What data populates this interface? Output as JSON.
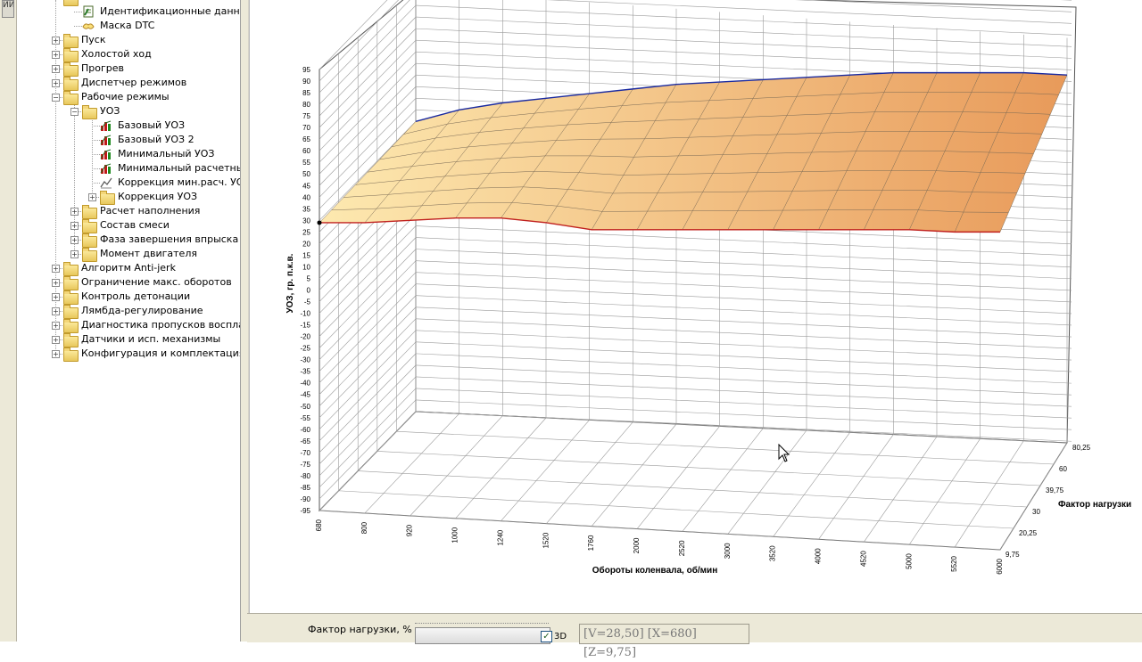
{
  "left_edge_tab": "ИИ",
  "tree": {
    "top_partial": "",
    "items": [
      {
        "label": "Идентификационные данные",
        "type": "doc",
        "level": 2
      },
      {
        "label": "Маска DTC",
        "type": "mask",
        "level": 2
      },
      {
        "label": "Пуск",
        "type": "folder",
        "level": 1,
        "expanded": false
      },
      {
        "label": "Холостой ход",
        "type": "folder",
        "level": 1,
        "expanded": false
      },
      {
        "label": "Прогрев",
        "type": "folder",
        "level": 1,
        "expanded": false
      },
      {
        "label": "Диспетчер режимов",
        "type": "folder",
        "level": 1,
        "expanded": false
      },
      {
        "label": "Рабочие режимы",
        "type": "folder",
        "level": 1,
        "expanded": true
      },
      {
        "label": "УОЗ",
        "type": "folder",
        "level": 2,
        "expanded": true
      },
      {
        "label": "Базовый УОЗ",
        "type": "chart",
        "level": 3
      },
      {
        "label": "Базовый УОЗ 2",
        "type": "chart",
        "level": 3
      },
      {
        "label": "Минимальный УОЗ",
        "type": "chart",
        "level": 3
      },
      {
        "label": "Минимальный расчетный",
        "type": "chart",
        "level": 3
      },
      {
        "label": "Коррекция мин.расч. УОЗ",
        "type": "line",
        "level": 3
      },
      {
        "label": "Коррекция УОЗ",
        "type": "folder",
        "level": 3,
        "expanded": false
      },
      {
        "label": "Расчет наполнения",
        "type": "folder",
        "level": 2,
        "expanded": false
      },
      {
        "label": "Состав смеси",
        "type": "folder",
        "level": 2,
        "expanded": false
      },
      {
        "label": "Фаза завершения впрыска",
        "type": "folder",
        "level": 2,
        "expanded": false
      },
      {
        "label": "Момент двигателя",
        "type": "folder",
        "level": 2,
        "expanded": false
      },
      {
        "label": "Алгоритм Anti-jerk",
        "type": "folder",
        "level": 1,
        "expanded": false
      },
      {
        "label": "Ограничение макс. оборотов",
        "type": "folder",
        "level": 1,
        "expanded": false
      },
      {
        "label": "Контроль детонации",
        "type": "folder",
        "level": 1,
        "expanded": false
      },
      {
        "label": "Лямбда-регулирование",
        "type": "folder",
        "level": 1,
        "expanded": false
      },
      {
        "label": "Диагностика пропусков воспламе",
        "type": "folder",
        "level": 1,
        "expanded": false
      },
      {
        "label": "Датчики и исп. механизмы",
        "type": "folder",
        "level": 1,
        "expanded": false
      },
      {
        "label": "Конфигурация и комплектация",
        "type": "folder",
        "level": 1,
        "expanded": false
      }
    ]
  },
  "chart_data": {
    "type": "surface3d",
    "ylabel": "УОЗ, гр. п.к.в.",
    "xlabel": "Обороты коленвала, об/мин",
    "zlabel": "Фактор нагрузки",
    "yticks": [
      "95",
      "90",
      "85",
      "80",
      "75",
      "70",
      "65",
      "60",
      "55",
      "50",
      "45",
      "40",
      "35",
      "30",
      "25",
      "20",
      "15",
      "10",
      "5",
      "0",
      "-5",
      "-10",
      "-15",
      "-20",
      "-25",
      "-30",
      "-35",
      "-40",
      "-45",
      "-50",
      "-55",
      "-60",
      "-65",
      "-70",
      "-75",
      "-80",
      "-85",
      "-90",
      "-95"
    ],
    "ylim": [
      -95,
      95
    ],
    "xticks": [
      "680",
      "800",
      "920",
      "1000",
      "1240",
      "1520",
      "1760",
      "2000",
      "2520",
      "3000",
      "3520",
      "4000",
      "4520",
      "5000",
      "5520",
      "6000"
    ],
    "zticks": [
      "9,75",
      "20,25",
      "30",
      "39,75",
      "60",
      "80,25"
    ],
    "front_edge": [
      29,
      29,
      30,
      31,
      31,
      29,
      26,
      26,
      26,
      26,
      26,
      26,
      26,
      26,
      25,
      25
    ],
    "back_edge": [
      30,
      35,
      38,
      40,
      42,
      44,
      46,
      47,
      48,
      49,
      50,
      51,
      51,
      51,
      51,
      50
    ],
    "colors": {
      "surface_light": "#fde9b0",
      "surface_dark": "#e89a5a",
      "front_line": "#c0201e",
      "back_line": "#1a2aa0",
      "grid": "#9a9a9a"
    }
  },
  "bottom": {
    "load_label": "Фактор нагрузки, %",
    "checkbox_3d_label": "3D",
    "checkbox_3d_checked": true,
    "status": "[V=28,50] [X=680] [Z=9,75]"
  }
}
